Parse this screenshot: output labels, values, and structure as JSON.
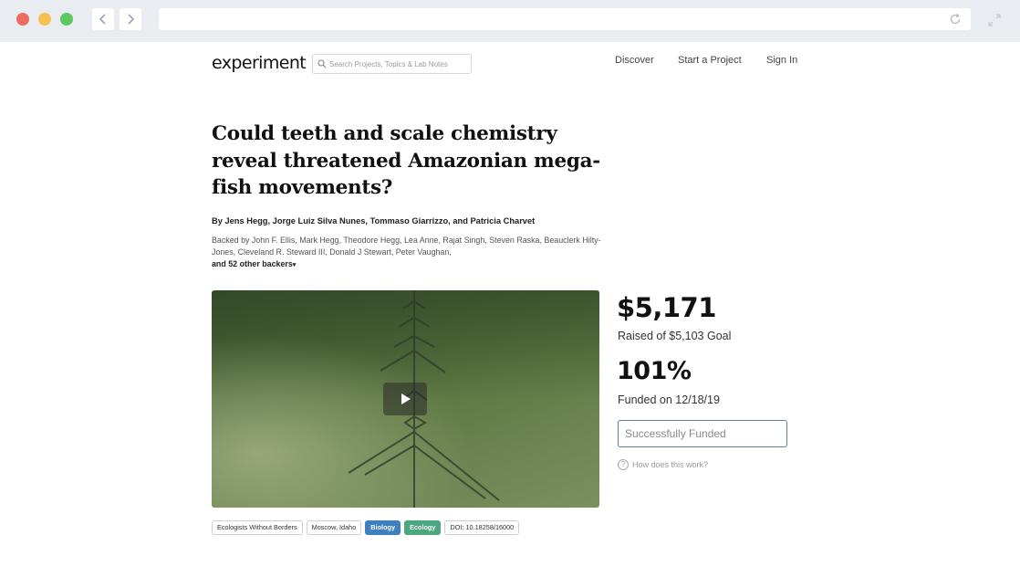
{
  "site": {
    "logo": "experiment",
    "search_placeholder": "Search Projects, Topics & Lab Notes",
    "nav": [
      "Discover",
      "Start a Project",
      "Sign In"
    ]
  },
  "project": {
    "title": "Could teeth and scale chemistry reveal threatened Amazonian mega-fish movements?",
    "authors": "By Jens Hegg, Jorge Luiz Silva Nunes, Tommaso Giarrizzo, and Patricia Charvet",
    "backers": "Backed by John F. Ellis, Mark Hegg, Theodore Hegg, Lea Anne, Rajat Singh, Steven Raska, Beauclerk Hilty-Jones, Cleveland R. Steward III, Donald J Stewart, Peter Vaughan,",
    "more_backers": "and 52 other backers",
    "tags": [
      {
        "label": "Ecologists Without Borders",
        "style": "plain"
      },
      {
        "label": "Moscow, Idaho",
        "style": "plain"
      },
      {
        "label": "Biology",
        "style": "biology"
      },
      {
        "label": "Ecology",
        "style": "ecology"
      },
      {
        "label": "DOI: 10.18258/16000",
        "style": "plain"
      }
    ]
  },
  "funding": {
    "amount": "$5,171",
    "goal_text": "Raised of $5,103 Goal",
    "percent": "101%",
    "funded_on": "Funded on 12/18/19",
    "status": "Successfully Funded",
    "how_link": "How does this work?"
  },
  "colors": {
    "biology": "#3f7fc0",
    "ecology": "#4aa780",
    "chrome": "#e9edf1"
  },
  "icons": {
    "search": "search-icon",
    "play": "play-icon",
    "help": "question-circle-icon"
  }
}
